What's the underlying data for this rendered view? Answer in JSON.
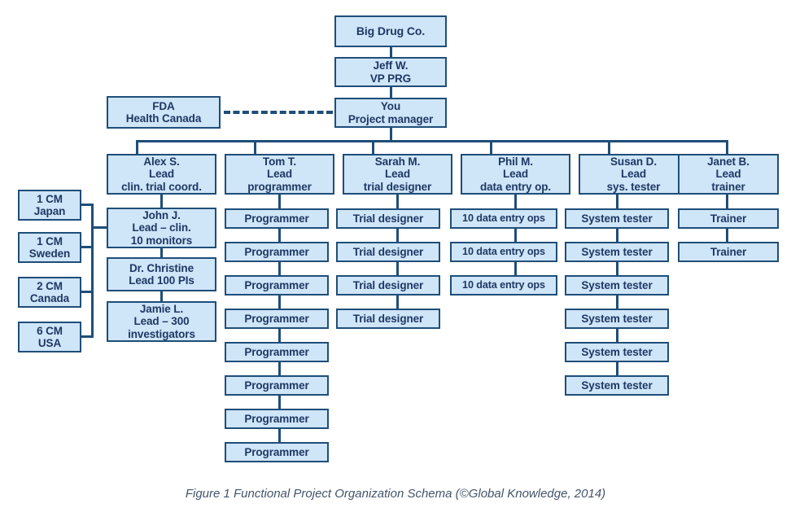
{
  "figure": {
    "caption": "Figure 1 Functional Project Organization Schema (©Global Knowledge, 2014)",
    "colors": {
      "box_fill": "#cfe5f8",
      "box_border": "#1f4e79",
      "text": "#1f3864",
      "connector": "#1f4e79",
      "caption_text": "#44546a",
      "background": "#ffffff"
    }
  },
  "top_chain": {
    "company": {
      "line1": "Big Drug Co."
    },
    "vp": {
      "line1": "Jeff W.",
      "line2": "VP PRG"
    },
    "project_manager": {
      "line1": "You",
      "line2": "Project manager"
    }
  },
  "external": {
    "regulators": {
      "line1": "FDA",
      "line2": "Health Canada"
    }
  },
  "monitors": [
    {
      "line1": "1 CM",
      "line2": "Japan"
    },
    {
      "line1": "1 CM",
      "line2": "Sweden"
    },
    {
      "line1": "2 CM",
      "line2": "Canada"
    },
    {
      "line1": "6 CM",
      "line2": "USA"
    }
  ],
  "columns": [
    {
      "lead": {
        "line1": "Alex S.",
        "line2": "Lead",
        "line3": "clin. trial coord."
      },
      "reports": [
        {
          "line1": "John J.",
          "line2": "Lead – clin.",
          "line3": "10 monitors"
        },
        {
          "line1": "Dr. Christine",
          "line2": "Lead 100 PIs"
        },
        {
          "line1": "Jamie L.",
          "line2": "Lead – 300",
          "line3": "investigators"
        }
      ]
    },
    {
      "lead": {
        "line1": "Tom T.",
        "line2": "Lead",
        "line3": "programmer"
      },
      "reports": [
        {
          "line1": "Programmer"
        },
        {
          "line1": "Programmer"
        },
        {
          "line1": "Programmer"
        },
        {
          "line1": "Programmer"
        },
        {
          "line1": "Programmer"
        },
        {
          "line1": "Programmer"
        },
        {
          "line1": "Programmer"
        },
        {
          "line1": "Programmer"
        }
      ]
    },
    {
      "lead": {
        "line1": "Sarah M.",
        "line2": "Lead",
        "line3": "trial designer"
      },
      "reports": [
        {
          "line1": "Trial designer"
        },
        {
          "line1": "Trial designer"
        },
        {
          "line1": "Trial designer"
        },
        {
          "line1": "Trial designer"
        }
      ]
    },
    {
      "lead": {
        "line1": "Phil M.",
        "line2": "Lead",
        "line3": "data entry op."
      },
      "reports": [
        {
          "line1": "10 data entry ops"
        },
        {
          "line1": "10 data entry ops"
        },
        {
          "line1": "10 data entry ops"
        }
      ]
    },
    {
      "lead": {
        "line1": "Susan D.",
        "line2": "Lead",
        "line3": "sys. tester"
      },
      "reports": [
        {
          "line1": "System tester"
        },
        {
          "line1": "System tester"
        },
        {
          "line1": "System tester"
        },
        {
          "line1": "System tester"
        },
        {
          "line1": "System tester"
        },
        {
          "line1": "System tester"
        }
      ]
    },
    {
      "lead": {
        "line1": "Janet B.",
        "line2": "Lead",
        "line3": "trainer"
      },
      "reports": [
        {
          "line1": "Trainer"
        },
        {
          "line1": "Trainer"
        }
      ]
    }
  ]
}
